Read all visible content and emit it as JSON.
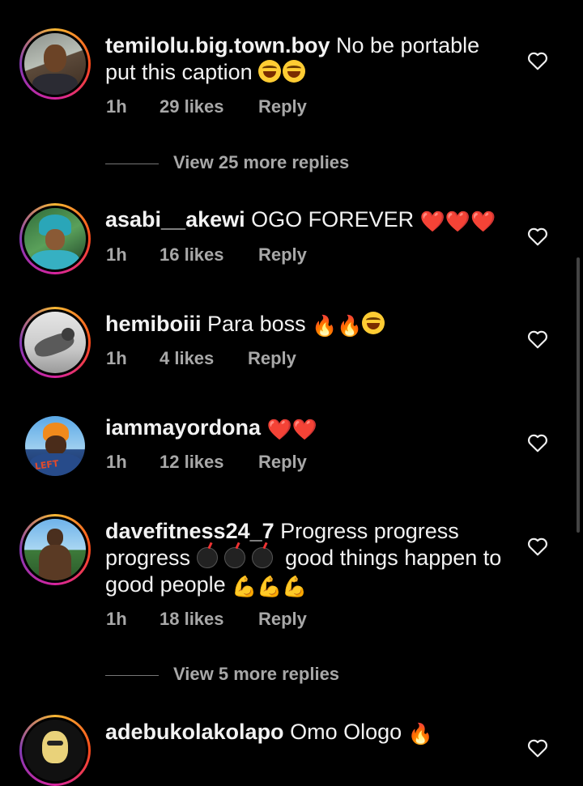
{
  "comments": [
    {
      "username": "temilolu.big.town.boy",
      "text": "No be portable put this caption",
      "emoji": [
        "laugh",
        "laugh"
      ],
      "time": "1h",
      "likes": "29 likes",
      "reply": "Reply",
      "view_more": "View 25 more replies"
    },
    {
      "username": "asabi__akewi",
      "text": "OGO FOREVER",
      "emoji": "❤️❤️❤️",
      "time": "1h",
      "likes": "16 likes",
      "reply": "Reply"
    },
    {
      "username": "hemiboiii",
      "text": "Para boss",
      "emoji": "🔥🔥",
      "time": "1h",
      "likes": "4 likes",
      "reply": "Reply"
    },
    {
      "username": "iammayordona",
      "text": "",
      "emoji": "❤️❤️",
      "time": "1h",
      "likes": "12 likes",
      "reply": "Reply"
    },
    {
      "username": "davefitness24_7",
      "text": "Progress progress progress",
      "text2": "good things happen to good people",
      "emoji": "💪💪💪",
      "time": "1h",
      "likes": "18 likes",
      "reply": "Reply",
      "view_more": "View 5 more replies"
    },
    {
      "username": "adebukolakolapo",
      "text": "Omo Ologo",
      "emoji": "🔥"
    }
  ],
  "icons": {
    "like": "heart-outline-icon"
  },
  "colors": {
    "background": "#000000",
    "text": "#f2f2f2",
    "muted": "#a8a8a8"
  }
}
